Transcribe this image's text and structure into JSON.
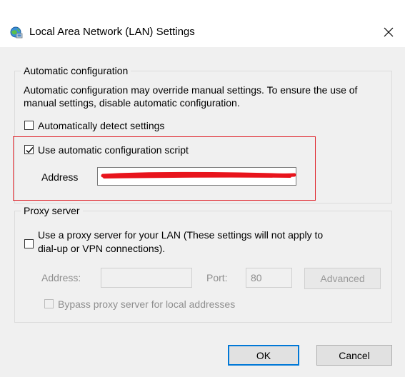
{
  "window": {
    "title": "Local Area Network (LAN) Settings",
    "icon": "network-globe-icon",
    "close_glyph": "✕"
  },
  "automatic_configuration": {
    "legend": "Automatic configuration",
    "description": "Automatic configuration may override manual settings.  To ensure the use of manual settings, disable automatic configuration.",
    "auto_detect": {
      "label": "Automatically detect settings",
      "checked": false
    },
    "auto_config_script": {
      "label": "Use automatic configuration script",
      "checked": true
    },
    "address_label": "Address",
    "address_value": ""
  },
  "proxy_server": {
    "legend": "Proxy server",
    "use_proxy": {
      "label_line1": "Use a proxy server for your LAN (These settings will not apply to",
      "label_line2": "dial-up or VPN connections).",
      "checked": false
    },
    "address_label": "Address:",
    "address_value": "",
    "port_label": "Port:",
    "port_value": "80",
    "advanced_label": "Advanced",
    "bypass": {
      "label": "Bypass proxy server for local addresses",
      "checked": false
    }
  },
  "buttons": {
    "ok": "OK",
    "cancel": "Cancel"
  },
  "colors": {
    "highlight_box": "#e0262d",
    "redaction": "#e8141c",
    "default_button_border": "#0078d7"
  }
}
